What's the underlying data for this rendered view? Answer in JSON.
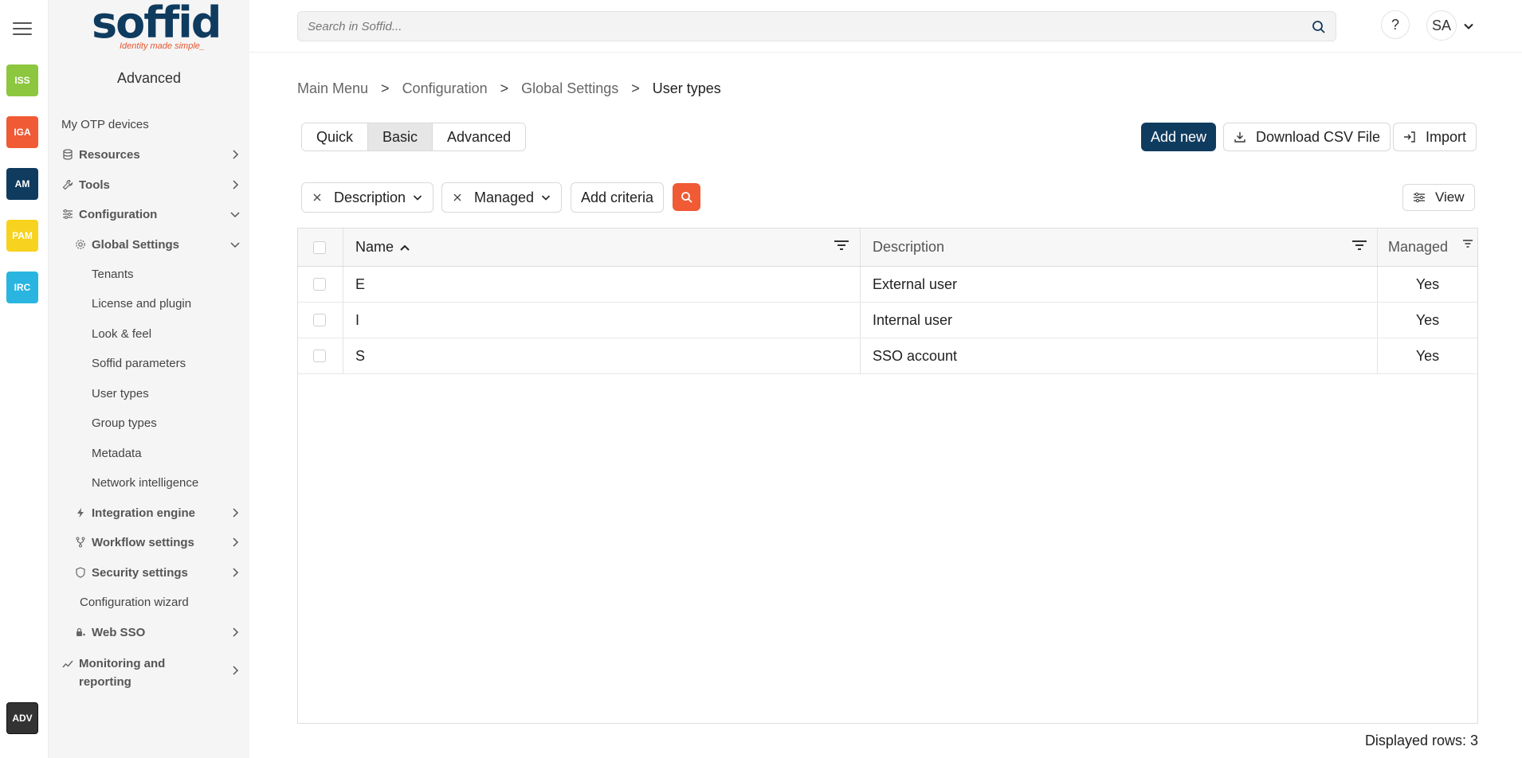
{
  "rail": {
    "modules": [
      {
        "label": "ISS",
        "color": "#8dc63f"
      },
      {
        "label": "IGA",
        "color": "#f05a35"
      },
      {
        "label": "AM",
        "color": "#0f3b5f"
      },
      {
        "label": "PAM",
        "color": "#f7d21e"
      },
      {
        "label": "IRC",
        "color": "#29b5e0"
      }
    ],
    "bottom_module": {
      "label": "ADV",
      "color": "#333333"
    }
  },
  "sidebar": {
    "logo_text": "soffid",
    "logo_tagline": "Identity made simple_",
    "title": "Advanced",
    "items": [
      {
        "label": "My OTP devices"
      },
      {
        "label": "Resources"
      },
      {
        "label": "Tools"
      },
      {
        "label": "Configuration"
      },
      {
        "label": "Global Settings"
      },
      {
        "label": "Tenants"
      },
      {
        "label": "License and plugin"
      },
      {
        "label": "Look & feel"
      },
      {
        "label": "Soffid parameters"
      },
      {
        "label": "User types"
      },
      {
        "label": "Group types"
      },
      {
        "label": "Metadata"
      },
      {
        "label": "Network intelligence"
      },
      {
        "label": "Integration engine"
      },
      {
        "label": "Workflow settings"
      },
      {
        "label": "Security settings"
      },
      {
        "label": "Configuration wizard"
      },
      {
        "label": "Web SSO"
      },
      {
        "label": "Monitoring and reporting"
      }
    ]
  },
  "header": {
    "search_placeholder": "Search in Soffid...",
    "help_label": "?",
    "user_initials": "SA"
  },
  "breadcrumb": {
    "items": [
      "Main Menu",
      "Configuration",
      "Global Settings",
      "User types"
    ],
    "separator": ">"
  },
  "toolbar": {
    "modes": [
      "Quick",
      "Basic",
      "Advanced"
    ],
    "active_mode": "Basic",
    "add_new": "Add new",
    "download_csv": "Download CSV File",
    "import": "Import"
  },
  "filters": {
    "chips": [
      "Description",
      "Managed"
    ],
    "add_criteria": "Add criteria",
    "view": "View"
  },
  "table": {
    "columns": [
      "Name",
      "Description",
      "Managed"
    ],
    "rows": [
      {
        "name": "E",
        "description": "External user",
        "managed": "Yes"
      },
      {
        "name": "I",
        "description": "Internal user",
        "managed": "Yes"
      },
      {
        "name": "S",
        "description": "SSO account",
        "managed": "Yes"
      }
    ],
    "displayed_rows": "Displayed rows: 3"
  },
  "colors": {
    "primary": "#0f3b5f",
    "accent": "#f05a35"
  }
}
